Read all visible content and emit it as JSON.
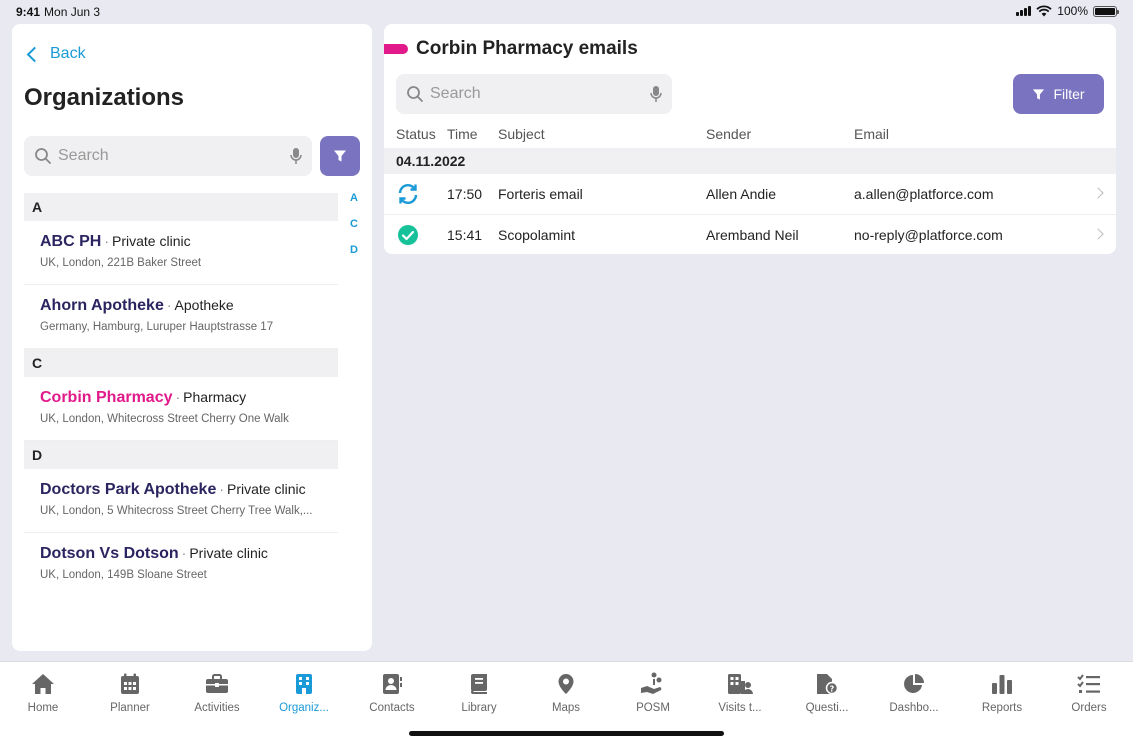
{
  "status_bar": {
    "time": "9:41",
    "date": "Mon Jun 3",
    "battery": "100%",
    "battery_level": 1.0
  },
  "left": {
    "back_label": "Back",
    "title": "Organizations",
    "search_placeholder": "Search",
    "index_letters": [
      "A",
      "C",
      "D"
    ],
    "sections": [
      {
        "letter": "A",
        "items": [
          {
            "name": "ABC PH",
            "type": "Private clinic",
            "address": "UK, London, 221B Baker Street",
            "active": false
          },
          {
            "name": "Ahorn Apotheke",
            "type": "Apotheke",
            "address": "Germany, Hamburg, Luruper Hauptstrasse 17",
            "active": false
          }
        ]
      },
      {
        "letter": "C",
        "items": [
          {
            "name": "Corbin Pharmacy",
            "type": "Pharmacy",
            "address": "UK, London, Whitecross Street Cherry One Walk",
            "active": true
          }
        ]
      },
      {
        "letter": "D",
        "items": [
          {
            "name": "Doctors Park Apotheke",
            "type": "Private clinic",
            "address": "UK, London, 5 Whitecross Street Cherry Tree Walk,...",
            "active": false
          },
          {
            "name": "Dotson Vs Dotson",
            "type": "Private clinic",
            "address": "UK, London, 149B Sloane Street",
            "active": false
          }
        ]
      }
    ],
    "separator": "·"
  },
  "right": {
    "title": "Corbin Pharmacy emails",
    "search_placeholder": "Search",
    "filter_label": "Filter",
    "columns": {
      "status": "Status",
      "time": "Time",
      "subject": "Subject",
      "sender": "Sender",
      "email": "Email"
    },
    "date_group": "04.11.2022",
    "rows": [
      {
        "status": "syncing",
        "time": "17:50",
        "subject": "Forteris email",
        "sender": "Allen Andie",
        "email": "a.allen@platforce.com"
      },
      {
        "status": "sent",
        "time": "15:41",
        "subject": "Scopolamint",
        "sender": "Aremband Neil",
        "email": "no-reply@platforce.com"
      }
    ]
  },
  "tabs": [
    {
      "label": "Home",
      "icon": "home-icon",
      "active": false
    },
    {
      "label": "Planner",
      "icon": "calendar-icon",
      "active": false
    },
    {
      "label": "Activities",
      "icon": "briefcase-icon",
      "active": false
    },
    {
      "label": "Organiz...",
      "icon": "building-icon",
      "active": true
    },
    {
      "label": "Contacts",
      "icon": "contact-card-icon",
      "active": false
    },
    {
      "label": "Library",
      "icon": "book-icon",
      "active": false
    },
    {
      "label": "Maps",
      "icon": "map-pin-icon",
      "active": false
    },
    {
      "label": "POSM",
      "icon": "hand-coins-icon",
      "active": false
    },
    {
      "label": "Visits t...",
      "icon": "buildings-person-icon",
      "active": false
    },
    {
      "label": "Questi...",
      "icon": "question-doc-icon",
      "active": false
    },
    {
      "label": "Dashbo...",
      "icon": "pie-chart-icon",
      "active": false
    },
    {
      "label": "Reports",
      "icon": "bar-chart-icon",
      "active": false
    },
    {
      "label": "Orders",
      "icon": "checklist-icon",
      "active": false
    }
  ],
  "colors": {
    "accent": "#1a9ad6",
    "brand_purple": "#7a74c0",
    "pink": "#e2198a",
    "org_name": "#2a2460",
    "success": "#17c29a"
  }
}
